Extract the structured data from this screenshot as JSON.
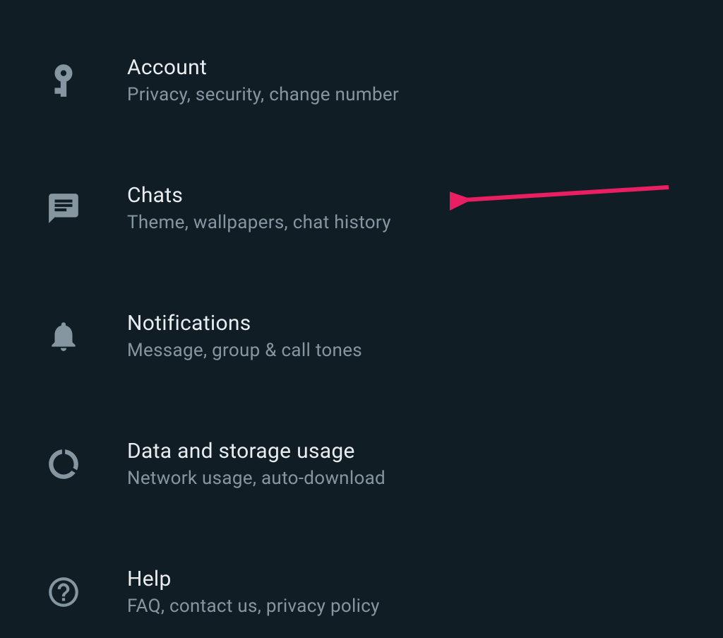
{
  "settings": {
    "items": [
      {
        "icon": "key",
        "title": "Account",
        "subtitle": "Privacy, security, change number"
      },
      {
        "icon": "chat",
        "title": "Chats",
        "subtitle": "Theme, wallpapers, chat history"
      },
      {
        "icon": "bell",
        "title": "Notifications",
        "subtitle": "Message, group & call tones"
      },
      {
        "icon": "data",
        "title": "Data and storage usage",
        "subtitle": "Network usage, auto-download"
      },
      {
        "icon": "help",
        "title": "Help",
        "subtitle": "FAQ, contact us, privacy policy"
      }
    ]
  },
  "annotation": {
    "arrow_color": "#e91e63"
  }
}
